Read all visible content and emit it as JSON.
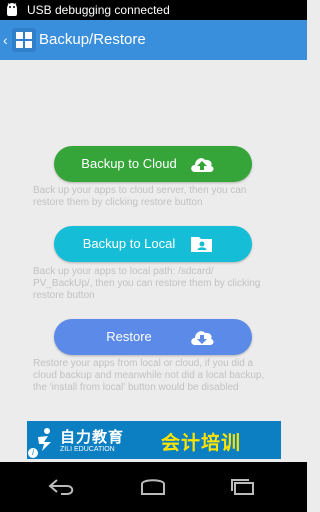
{
  "status_bar": {
    "notification_icon": "android-debug-icon",
    "text": "USB debugging connected"
  },
  "action_bar": {
    "title": "Backup/Restore",
    "icon": "app-grid-icon",
    "back_icon": "chevron-left-icon",
    "color": "#3a8fdc"
  },
  "actions": {
    "cloud": {
      "label": "Backup to Cloud",
      "icon": "cloud-upload-icon",
      "color": "#35a53a",
      "description": "Back up your apps to cloud server, then you can restore them by clicking restore button"
    },
    "local": {
      "label": "Backup to Local",
      "icon": "folder-user-icon",
      "color": "#15bdd6",
      "description": "Back up your apps to local path: /sdcard/ PV_BackUp/, then you can restore them by clicking restore button"
    },
    "restore": {
      "label": "Restore",
      "icon": "cloud-download-icon",
      "color": "#5b8ae8",
      "description": "Restore your apps from local or cloud, if you did a cloud backup and meanwhile not did a local backup, the 'install from local' button would be disabled"
    }
  },
  "ad": {
    "brand_cn": "自力教育",
    "brand_en": "ZILI EDUCATION",
    "slogan": "会计培训",
    "info_icon": "info-icon",
    "colors": {
      "background": "#0b7fc2",
      "slogan": "#ffe400"
    }
  },
  "nav_bar": {
    "icons": [
      "back-icon",
      "home-icon",
      "recents-icon"
    ]
  }
}
